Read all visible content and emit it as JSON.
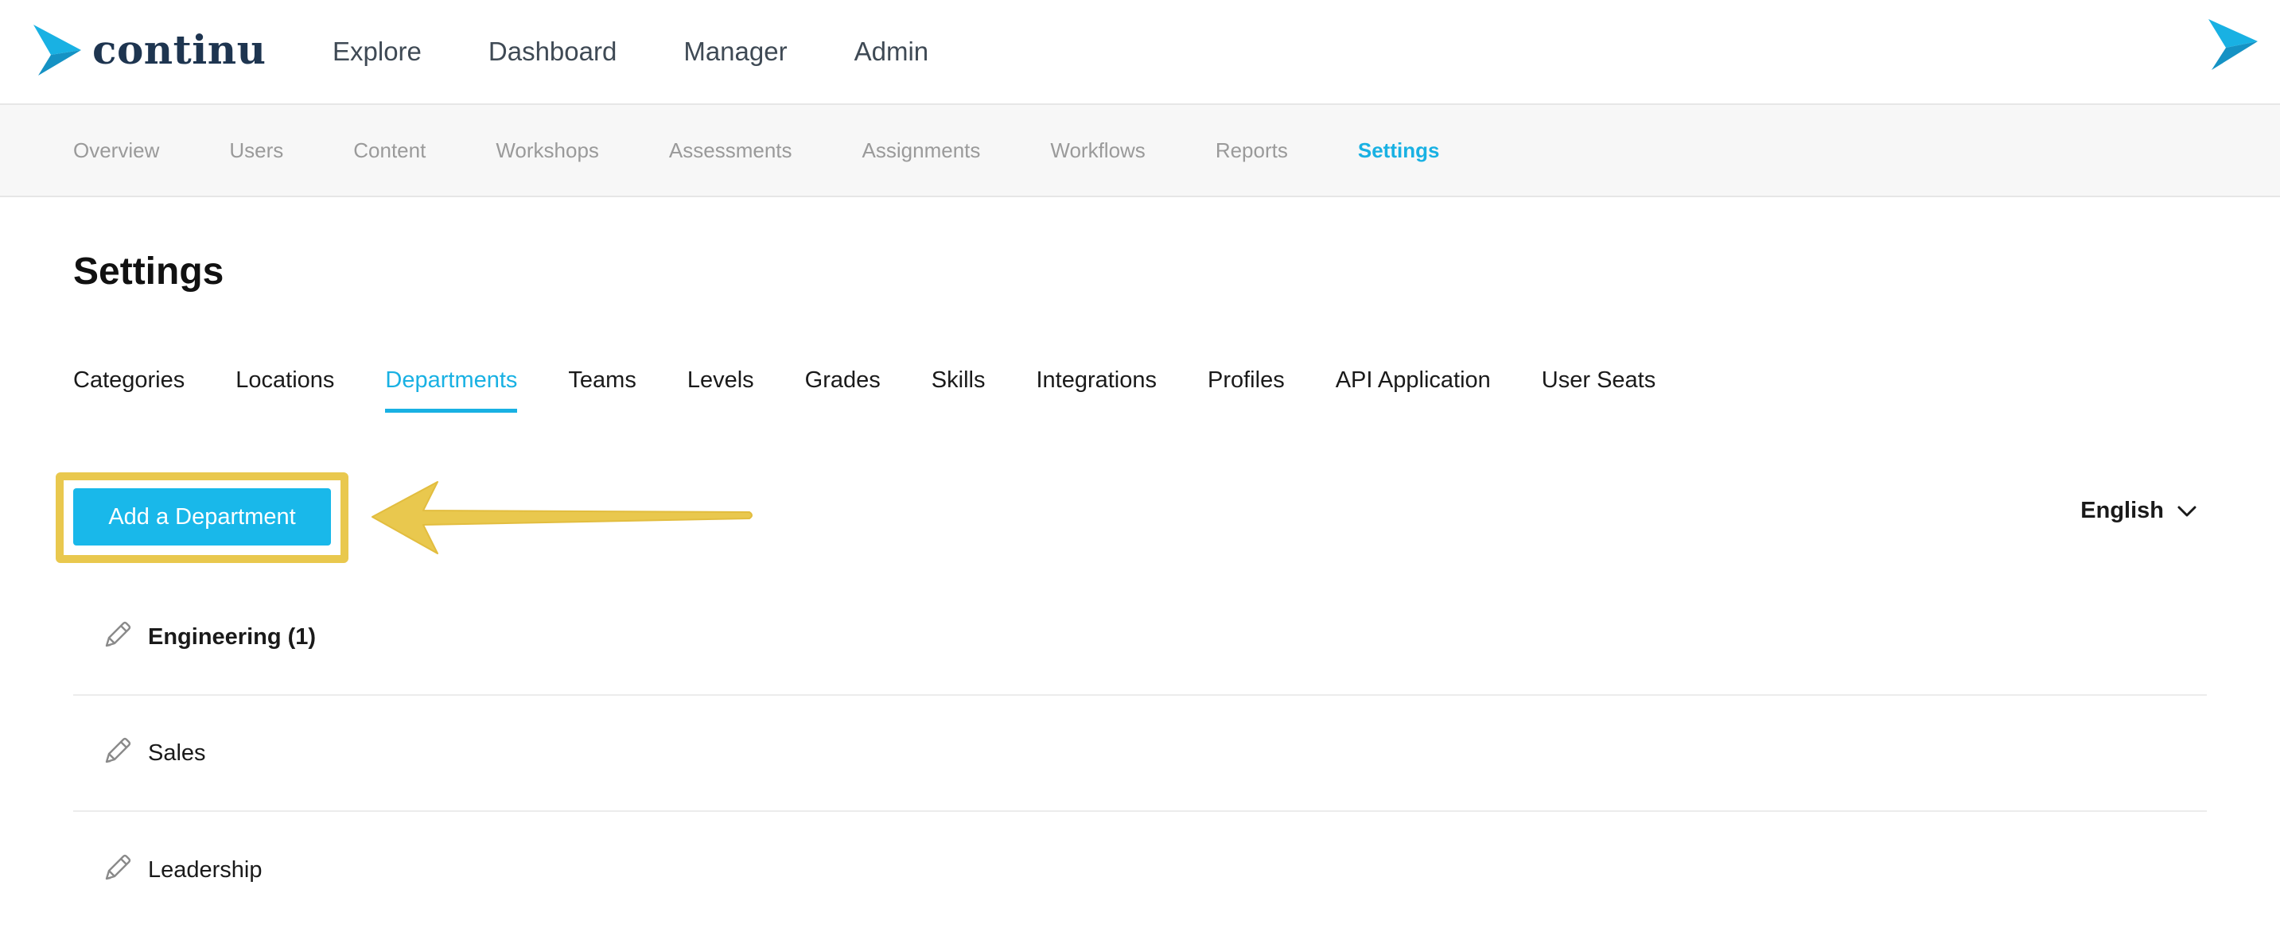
{
  "brand": {
    "name": "continu",
    "accent_color": "#19b1e3",
    "highlight_color": "#e9c84e"
  },
  "main_nav": {
    "items": [
      {
        "label": "Explore"
      },
      {
        "label": "Dashboard"
      },
      {
        "label": "Manager"
      },
      {
        "label": "Admin"
      }
    ]
  },
  "sub_nav": {
    "items": [
      {
        "label": "Overview"
      },
      {
        "label": "Users"
      },
      {
        "label": "Content"
      },
      {
        "label": "Workshops"
      },
      {
        "label": "Assessments"
      },
      {
        "label": "Assignments"
      },
      {
        "label": "Workflows"
      },
      {
        "label": "Reports"
      },
      {
        "label": "Settings",
        "active": true
      }
    ]
  },
  "page": {
    "title": "Settings"
  },
  "tabs": {
    "items": [
      {
        "label": "Categories"
      },
      {
        "label": "Locations"
      },
      {
        "label": "Departments",
        "active": true
      },
      {
        "label": "Teams"
      },
      {
        "label": "Levels"
      },
      {
        "label": "Grades"
      },
      {
        "label": "Skills"
      },
      {
        "label": "Integrations"
      },
      {
        "label": "Profiles"
      },
      {
        "label": "API Application"
      },
      {
        "label": "User Seats"
      }
    ]
  },
  "toolbar": {
    "add_label": "Add a Department",
    "language": "English"
  },
  "departments": {
    "items": [
      {
        "name": "Engineering (1)",
        "bold": true
      },
      {
        "name": "Sales",
        "bold": false
      },
      {
        "name": "Leadership",
        "bold": false
      }
    ]
  },
  "icons": {
    "logo": "continu-chevron-logo-icon",
    "edit": "pencil-icon",
    "dropdown": "chevron-down-icon",
    "annotation": "arrow-left-icon"
  }
}
